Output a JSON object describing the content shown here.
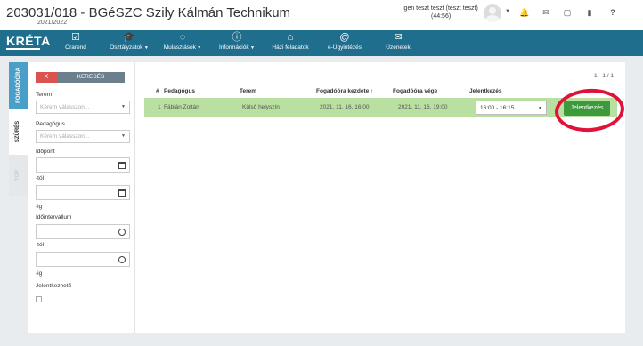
{
  "header": {
    "school_title": "203031/018 - BGéSZC Szily Kálmán Technikum",
    "school_year": "2021/2022",
    "user_name": "igen teszt teszt (teszt teszt)",
    "session_time": "(44:56)",
    "icons": [
      "user-avatar",
      "bell-icon",
      "mail-icon",
      "chat-icon",
      "book-icon",
      "help-icon"
    ],
    "help_glyph": "?"
  },
  "navbar": {
    "logo": "KRÉTA",
    "items": [
      {
        "label": "Órarend",
        "icon": "calendar-check",
        "dropdown": false
      },
      {
        "label": "Osztályzatok",
        "icon": "graduation-cap",
        "dropdown": true
      },
      {
        "label": "Mulasztások",
        "icon": "spinner",
        "dropdown": true
      },
      {
        "label": "Információk",
        "icon": "info-circle",
        "dropdown": true
      },
      {
        "label": "Házi feladatok",
        "icon": "home",
        "dropdown": false
      },
      {
        "label": "e-Ügyintézés",
        "icon": "at-sign",
        "dropdown": false
      },
      {
        "label": "Üzenetek",
        "icon": "envelope",
        "dropdown": false
      }
    ]
  },
  "vertical_tabs": [
    "FOGADÓÓRA",
    "SZŰRÉS",
    "TOP"
  ],
  "filter": {
    "clear_label": "X",
    "search_label": "KERESÉS",
    "teremlabel": "Terem",
    "terem_placeholder": "Kérem válasszon...",
    "pedagogus_label": "Pedagógus",
    "pedagogus_placeholder": "Kérem válasszon...",
    "idopont_label": "Időpont",
    "tol_label": "-tól",
    "ig_label": "-ig",
    "idointervallum_label": "Időintervallum",
    "tol2_label": "-tól",
    "ig2_label": "-ig",
    "jelentkezheto_label": "Jelentkezhető"
  },
  "table": {
    "page_count": "1 - 1 / 1",
    "columns": [
      "#",
      "Pedagógus",
      "Terem",
      "Fogadóóra kezdete",
      "Fogadóóra vége",
      "Jelentkezés"
    ],
    "sort_indicator": "↑",
    "rows": [
      {
        "index": "1",
        "pedagogus": "Fábián Zoltán",
        "terem": "Külső helyszín",
        "kezdete": "2021. 11. 16. 16:00",
        "vege": "2021. 11. 16. 19:00",
        "selected_slot": "16:00 - 16:15",
        "button_label": "Jelentkezés"
      }
    ]
  },
  "colors": {
    "navbar": "#1f6e8e",
    "active_tab": "#4a9fc9",
    "row_highlight": "#b9dfa1",
    "primary_button": "#3c9a3c",
    "clear_button": "#d9534f",
    "annotation": "#e0123a"
  }
}
